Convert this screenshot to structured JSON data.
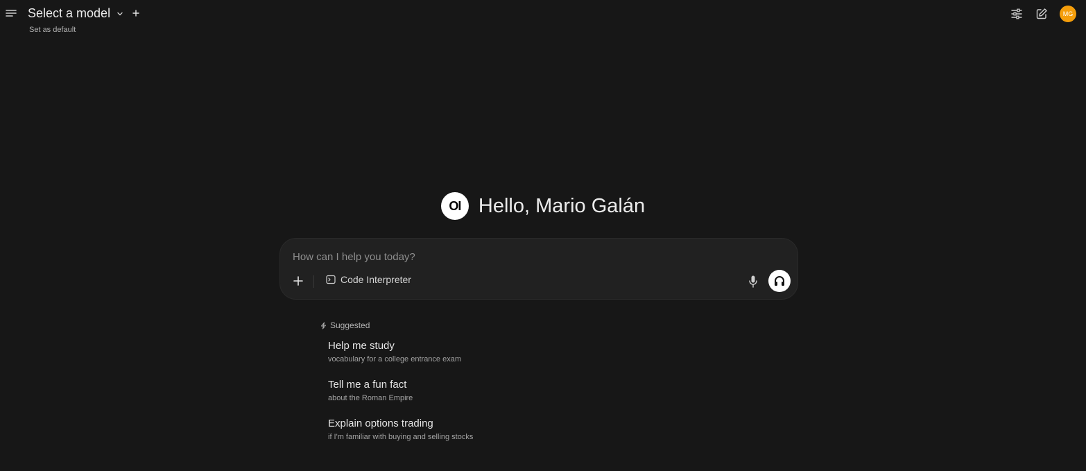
{
  "header": {
    "model_select_label": "Select a model",
    "set_default_label": "Set as default",
    "avatar_initials": "MG",
    "avatar_color": "#f59e0b"
  },
  "greeting": {
    "logo_text": "OI",
    "text": "Hello, Mario Galán"
  },
  "composer": {
    "placeholder": "How can I help you today?",
    "code_interpreter_label": "Code Interpreter"
  },
  "suggestions": {
    "header": "Suggested",
    "items": [
      {
        "title": "Help me study",
        "subtitle": "vocabulary for a college entrance exam"
      },
      {
        "title": "Tell me a fun fact",
        "subtitle": "about the Roman Empire"
      },
      {
        "title": "Explain options trading",
        "subtitle": "if I'm familiar with buying and selling stocks"
      }
    ]
  },
  "colors": {
    "background": "#171717",
    "composer_bg": "#212121",
    "accent": "#f59e0b"
  }
}
